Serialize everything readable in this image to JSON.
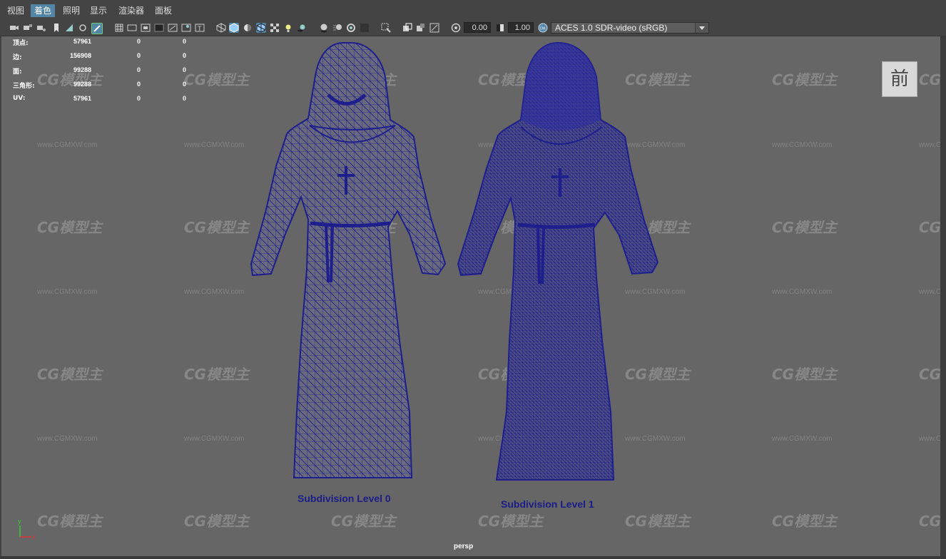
{
  "menu": [
    {
      "label": "视图"
    },
    {
      "label": "着色",
      "active": true
    },
    {
      "label": "照明"
    },
    {
      "label": "显示"
    },
    {
      "label": "渲染器"
    },
    {
      "label": "面板"
    }
  ],
  "toolbar": {
    "exposure_value": "0.00",
    "gamma_value": "1.00",
    "color_space": "ACES 1.0 SDR-video (sRGB)"
  },
  "hud": {
    "rows": [
      {
        "label": "顶点:",
        "v1": "57961",
        "v2": "0",
        "v3": "0"
      },
      {
        "label": "边:",
        "v1": "156908",
        "v2": "0",
        "v3": "0"
      },
      {
        "label": "面:",
        "v1": "99288",
        "v2": "0",
        "v3": "0"
      },
      {
        "label": "三角形:",
        "v1": "99288",
        "v2": "0",
        "v3": "0"
      },
      {
        "label": "UV:",
        "v1": "57961",
        "v2": "0",
        "v3": "0"
      }
    ]
  },
  "view_cube_label": "前",
  "captions": {
    "left": "Subdivision Level 0",
    "right": "Subdivision Level 1"
  },
  "camera_label": "persp",
  "watermark": {
    "logo": "CG模型主",
    "url": "www.CGMXW.com"
  },
  "axis": {
    "x": "x",
    "y": "y"
  },
  "colors": {
    "wire": "#1e1e8c",
    "viewport_bg": "#666666",
    "accent": "#5285a6"
  }
}
